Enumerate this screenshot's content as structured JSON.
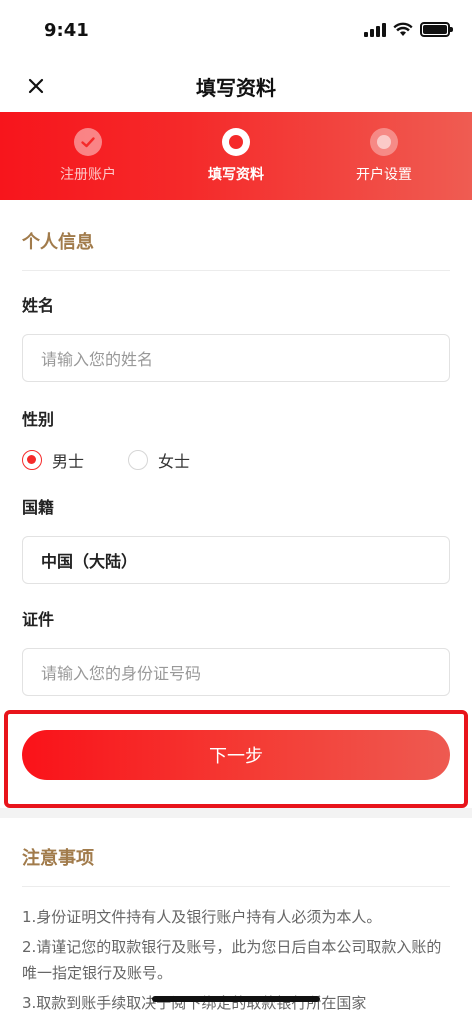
{
  "status_bar": {
    "time": "9:41"
  },
  "nav": {
    "title": "填写资料"
  },
  "steps": [
    {
      "label": "注册账户",
      "state": "done"
    },
    {
      "label": "填写资料",
      "state": "current"
    },
    {
      "label": "开户设置",
      "state": "todo"
    }
  ],
  "personal_info": {
    "section_title": "个人信息",
    "name": {
      "label": "姓名",
      "placeholder": "请输入您的姓名"
    },
    "gender": {
      "label": "性别",
      "options": [
        "男士",
        "女士"
      ],
      "selected": "男士"
    },
    "nationality": {
      "label": "国籍",
      "value": "中国（大陆）"
    },
    "id_doc": {
      "label": "证件",
      "placeholder": "请输入您的身份证号码"
    }
  },
  "next_button": {
    "label": "下一步"
  },
  "notice": {
    "title": "注意事项",
    "items": [
      "1.身份证明文件持有人及银行账户持有人必须为本人。",
      "2.请谨记您的取款银行及账号，此为您日后自本公司取款入账的唯一指定银行及账号。",
      "3.取款到账手续取决于阅下绑定的取款银行所在国家"
    ]
  },
  "colors": {
    "accent": "#f52a2a",
    "section_title": "#a17b4b"
  }
}
